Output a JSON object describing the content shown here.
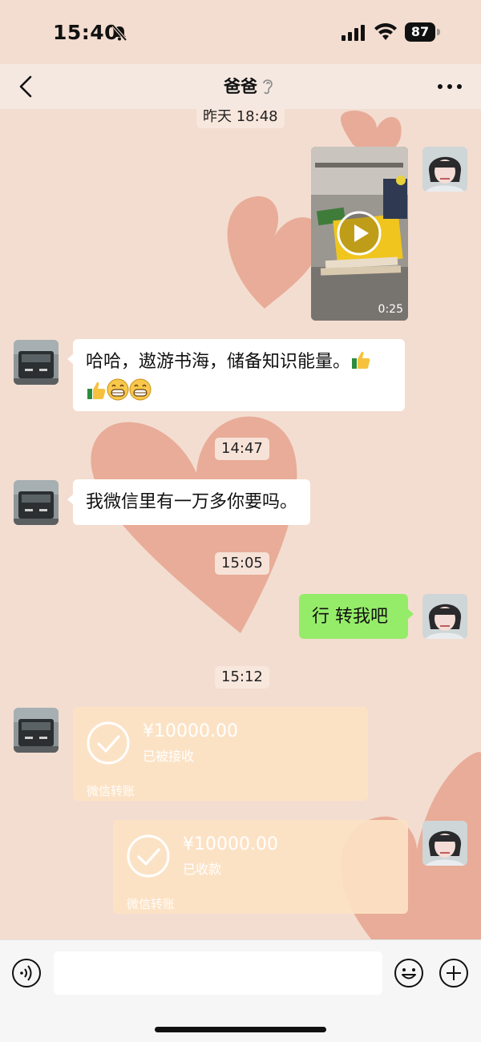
{
  "status_bar": {
    "time": "15:40",
    "battery": "87"
  },
  "header": {
    "title": "爸爸"
  },
  "messages": {
    "t1": "昨天 18:48",
    "video_duration": "0:25",
    "m1_text": "哈哈，遨游书海，储备知识能量。",
    "t2": "14:47",
    "m2_text": "我微信里有一万多你要吗。",
    "t3": "15:05",
    "m3_text": "行 转我吧",
    "t4": "15:12",
    "transfer1": {
      "amount": "¥10000.00",
      "status": "已被接收",
      "footer": "微信转账"
    },
    "transfer2": {
      "amount": "¥10000.00",
      "status": "已收款",
      "footer": "微信转账"
    }
  },
  "colors": {
    "bubble_green": "#95ec69",
    "transfer_bg": "#fce2c4",
    "wallpaper": "#f3ddd0",
    "heart": "#e08f7a"
  }
}
